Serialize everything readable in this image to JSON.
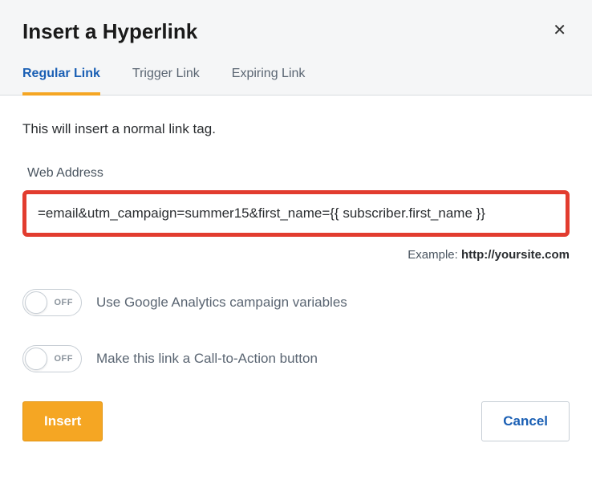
{
  "header": {
    "title": "Insert a Hyperlink",
    "close_text": "✕"
  },
  "tabs": {
    "regular": "Regular Link",
    "trigger": "Trigger Link",
    "expiring": "Expiring Link"
  },
  "content": {
    "description": "This will insert a normal link tag.",
    "field_label": "Web Address",
    "url_value": "=email&utm_campaign=summer15&first_name={{ subscriber.first_name }}",
    "example_prefix": "Example: ",
    "example_url": "http://yoursite.com"
  },
  "toggles": {
    "off_label": "OFF",
    "analytics_text": "Use Google Analytics campaign variables",
    "cta_text": "Make this link a Call-to-Action button"
  },
  "footer": {
    "insert_label": "Insert",
    "cancel_label": "Cancel"
  }
}
